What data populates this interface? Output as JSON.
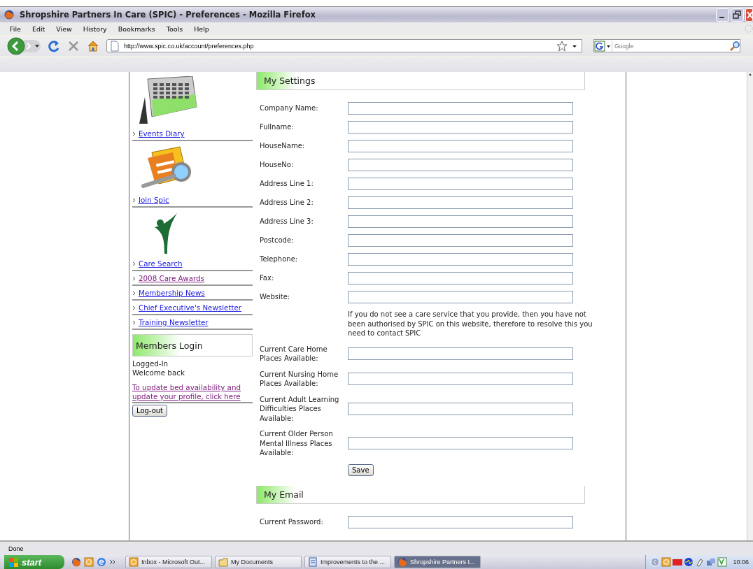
{
  "window": {
    "title": "Shropshire Partners In Care (SPIC) - Preferences - Mozilla Firefox"
  },
  "menu": [
    "File",
    "Edit",
    "View",
    "History",
    "Bookmarks",
    "Tools",
    "Help"
  ],
  "address_bar": {
    "url": "http://www.spic.co.uk/account/preferences.php"
  },
  "search": {
    "placeholder": "Google"
  },
  "sidebar": {
    "items": [
      {
        "label": "Events Diary",
        "kind": "calendar",
        "visited": false
      },
      {
        "label": "Join Spic",
        "kind": "magnifier",
        "visited": false
      },
      {
        "label": "Care Search",
        "kind": "figure",
        "visited": false
      },
      {
        "label": "2008 Care Awards",
        "kind": "link",
        "visited": true
      },
      {
        "label": "Membership News",
        "kind": "link",
        "visited": false
      },
      {
        "label": "Chief Executive's Newsletter",
        "kind": "link",
        "visited": false
      },
      {
        "label": "Training Newsletter",
        "kind": "link",
        "visited": false
      }
    ]
  },
  "members_login": {
    "title": "Members Login",
    "status": "Logged-In",
    "welcome": "Welcome back",
    "link": "To update bed availability and update your profile, click here",
    "link_visited": true,
    "button": "Log-out"
  },
  "settings": {
    "title": "My Settings",
    "rows": [
      {
        "kind": "field",
        "label": "Company Name:"
      },
      {
        "kind": "field",
        "label": "Fullname:"
      },
      {
        "kind": "field",
        "label": "HouseName:"
      },
      {
        "kind": "field",
        "label": "HouseNo:"
      },
      {
        "kind": "field",
        "label": "Address Line 1:"
      },
      {
        "kind": "field",
        "label": "Address Line 2:"
      },
      {
        "kind": "field",
        "label": "Address Line 3:"
      },
      {
        "kind": "field",
        "label": "Postcode:"
      },
      {
        "kind": "field",
        "label": "Telephone:"
      },
      {
        "kind": "field",
        "label": "Fax:"
      },
      {
        "kind": "field",
        "label": "Website:"
      },
      {
        "kind": "note",
        "text": "If you do not see a care service that you provide, then you have not been authorised by SPIC on this website, therefore to resolve this you need to contact SPIC"
      },
      {
        "kind": "field",
        "label": "Current Care Home Places Available:"
      },
      {
        "kind": "field",
        "label": "Current Nursing Home Places Available:"
      },
      {
        "kind": "field",
        "label": "Current Adult Learning Difficulties Places Available:"
      },
      {
        "kind": "field",
        "label": "Current Older Person Mental Illness Places Available:"
      }
    ],
    "save": "Save"
  },
  "email": {
    "title": "My Email",
    "rows": [
      {
        "kind": "field",
        "label": "Current Password:"
      }
    ]
  },
  "status_bar": {
    "text": "Done"
  },
  "taskbar": {
    "start": "start",
    "tasks": [
      {
        "label": "Inbox - Microsoft Out...",
        "kind": "mail",
        "selected": false
      },
      {
        "label": "My Documents",
        "kind": "folder",
        "selected": false
      },
      {
        "label": "Improvements to the ...",
        "kind": "document",
        "selected": false
      },
      {
        "label": "Shropshire Partners I...",
        "kind": "browser",
        "selected": true
      }
    ],
    "clock": "10:06"
  }
}
